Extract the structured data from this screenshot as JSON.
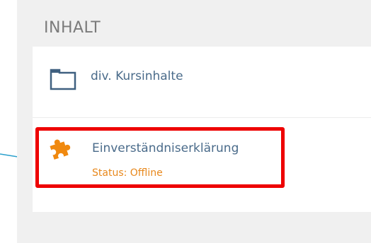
{
  "section": {
    "title": "INHALT"
  },
  "items": [
    {
      "label": "div. Kursinhalte",
      "icon": "folder-icon"
    },
    {
      "label": "Einverständniserklärung",
      "icon": "puzzle-icon",
      "status": "Status: Offline"
    }
  ],
  "colors": {
    "panel_bg": "#f0f0f0",
    "title": "#7b7b7b",
    "link": "#4a6b8a",
    "status": "#e8881c",
    "highlight": "#ee0000",
    "icon_folder": "#3f6080",
    "icon_puzzle": "#f0890f",
    "connector": "#2aa0cc"
  }
}
